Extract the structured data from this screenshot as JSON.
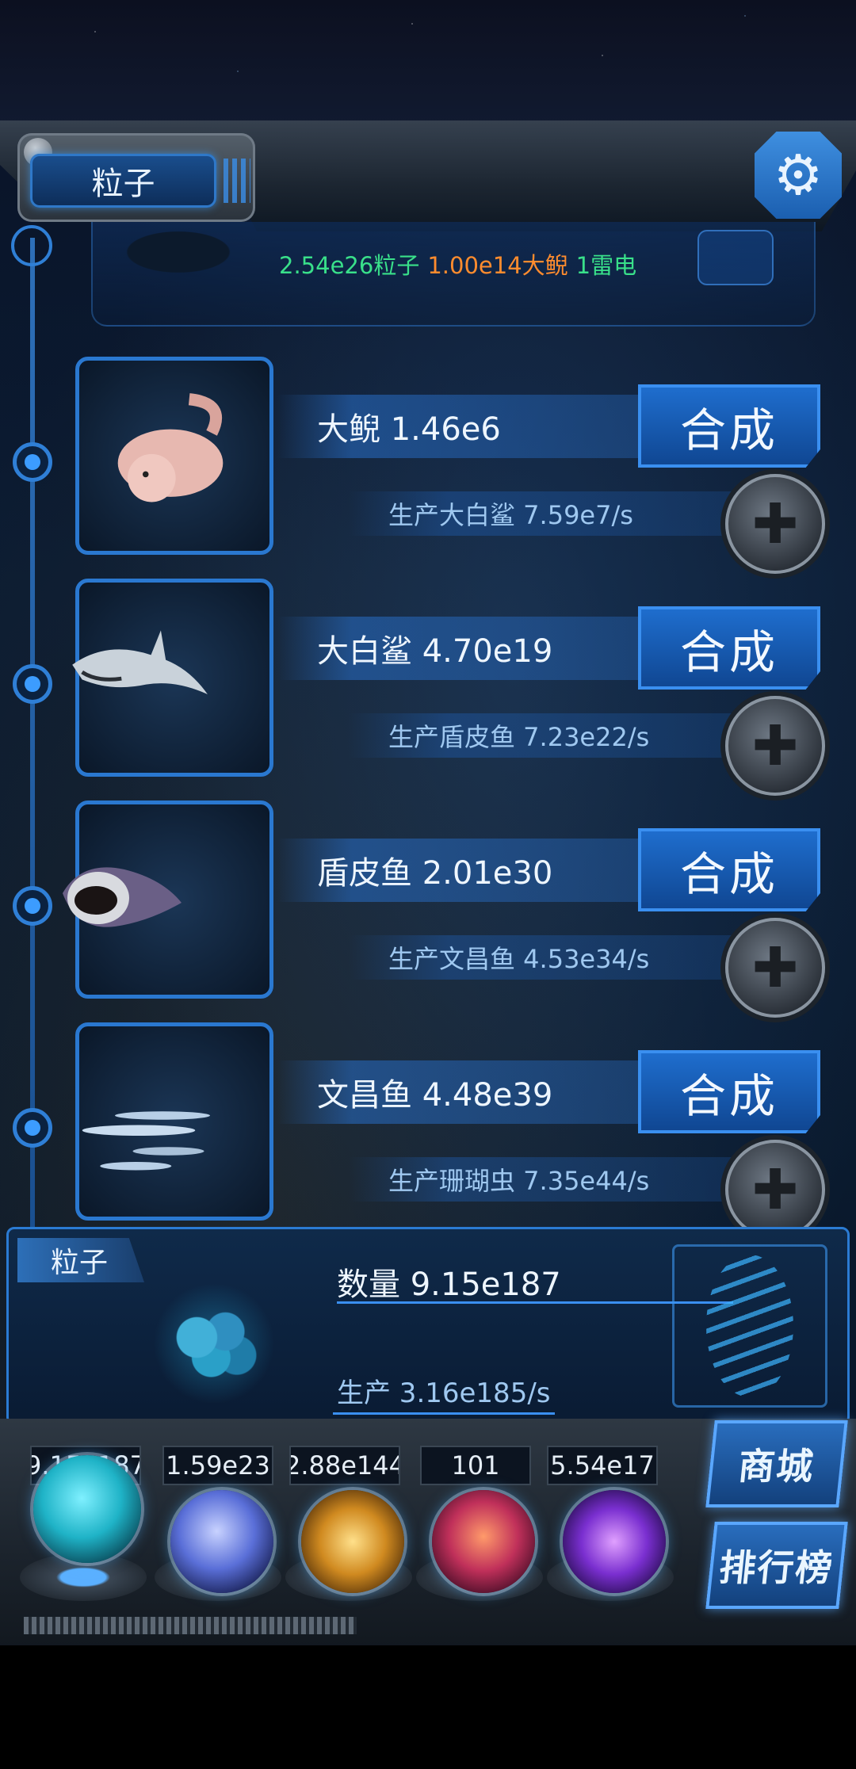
{
  "header": {
    "title": "粒子",
    "resources": {
      "particles": "2.54e26粒子",
      "salamander": "1.00e14大鲵",
      "thunder": "1雷电"
    }
  },
  "creatures": [
    {
      "name": "大鲵 1.46e6",
      "production": "生产大白鲨 7.59e7/s",
      "action": "合成",
      "icon": "salamander"
    },
    {
      "name": "大白鲨 4.70e19",
      "production": "生产盾皮鱼 7.23e22/s",
      "action": "合成",
      "icon": "great-white-shark"
    },
    {
      "name": "盾皮鱼 2.01e30",
      "production": "生产文昌鱼 4.53e34/s",
      "action": "合成",
      "icon": "placoderm"
    },
    {
      "name": "文昌鱼 4.48e39",
      "production": "生产珊瑚虫 7.35e44/s",
      "action": "合成",
      "icon": "lancelet"
    }
  ],
  "particle_panel": {
    "tag": "粒子",
    "quantity": "数量 9.15e187",
    "production": "生产 3.16e185/s"
  },
  "bottom": {
    "counters": [
      "9.15e187",
      "1.59e23",
      "2.88e144",
      "101",
      "5.54e17"
    ],
    "orbs": [
      {
        "icon": "particle-orb",
        "color": "#1fb3c7"
      },
      {
        "icon": "lightning-orb",
        "color": "#5a6fd8"
      },
      {
        "icon": "galaxy-orb",
        "color": "#d08a20"
      },
      {
        "icon": "brain-orb",
        "color": "#c0305a"
      },
      {
        "icon": "vortex-orb",
        "color": "#7a2fd0"
      }
    ],
    "shop_label": "商城",
    "rank_label": "排行榜"
  },
  "colors": {
    "accent": "#2f7fd6",
    "green": "#39e08a",
    "orange": "#ff8c2e"
  }
}
